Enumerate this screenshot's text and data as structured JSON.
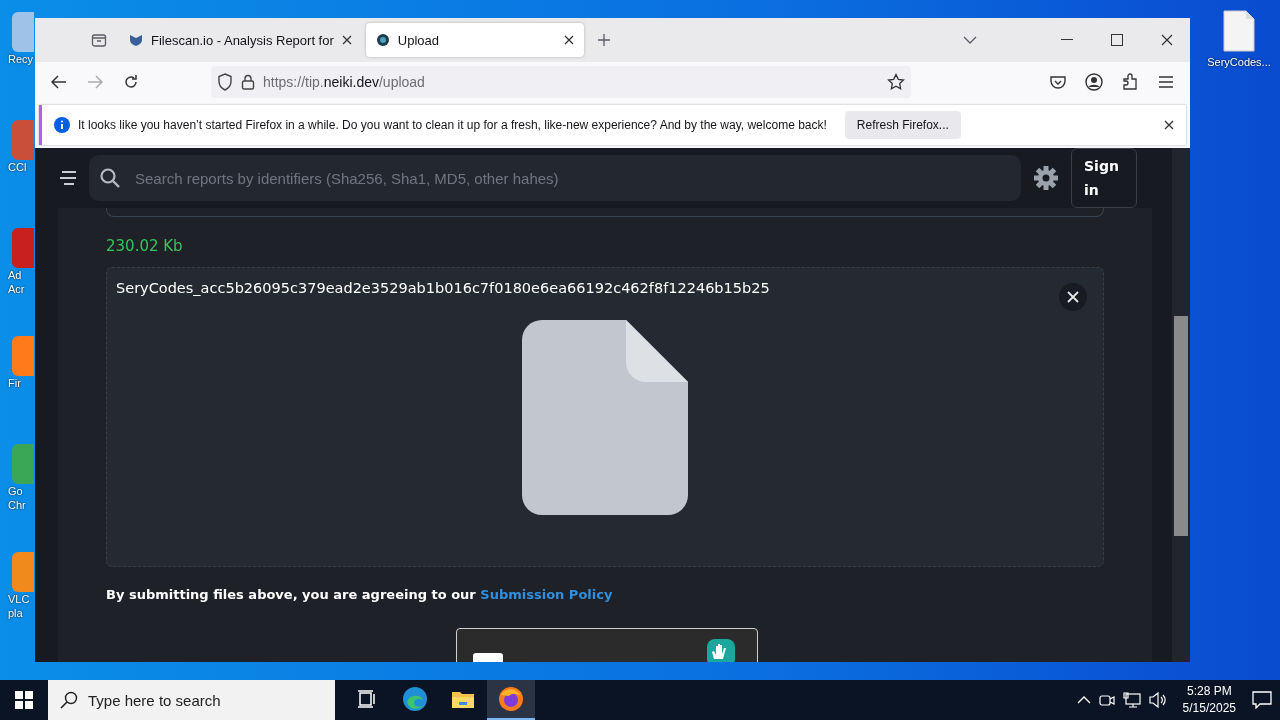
{
  "desktop": {
    "icons": [
      {
        "label": "Recy"
      },
      {
        "label": "CCl"
      },
      {
        "label": "Ad Acr"
      },
      {
        "label": "Fir"
      },
      {
        "label": "Go Chr"
      },
      {
        "label": "VLC pla"
      }
    ],
    "right_icon": {
      "label": "SeryCodes..."
    }
  },
  "browser": {
    "tabs": [
      {
        "title": "Filescan.io - Analysis Report for",
        "selected": false
      },
      {
        "title": "Upload",
        "selected": true
      }
    ],
    "url": {
      "prefix": "https://tip.",
      "domain": "neiki.dev",
      "path": "/upload"
    },
    "notification": {
      "message": "It looks like you haven’t started Firefox in a while. Do you want to clean it up for a fresh, like-new experience? And by the way, welcome back!",
      "button": "Refresh Firefox..."
    }
  },
  "page": {
    "search": {
      "placeholder": "Search reports by identifiers (Sha256, Sha1, MD5, other hahes)"
    },
    "sign_in": "Sign in",
    "file_size": "230.02 Kb",
    "file_name": "SeryCodes_acc5b26095c379ead2e3529ab1b016c7f0180e6ea66192c462f8f12246b15b25",
    "agreement": {
      "text": "By submitting files above, you are agreeing to our",
      "link": "Submission Policy"
    }
  },
  "taskbar": {
    "search_placeholder": "Type here to search",
    "apps": [
      {
        "kind": "taskview",
        "selected": false
      },
      {
        "kind": "edge",
        "selected": false
      },
      {
        "kind": "explorer",
        "selected": false
      },
      {
        "kind": "firefox",
        "selected": true
      }
    ],
    "time": "5:28 PM",
    "date": "5/15/2025"
  }
}
